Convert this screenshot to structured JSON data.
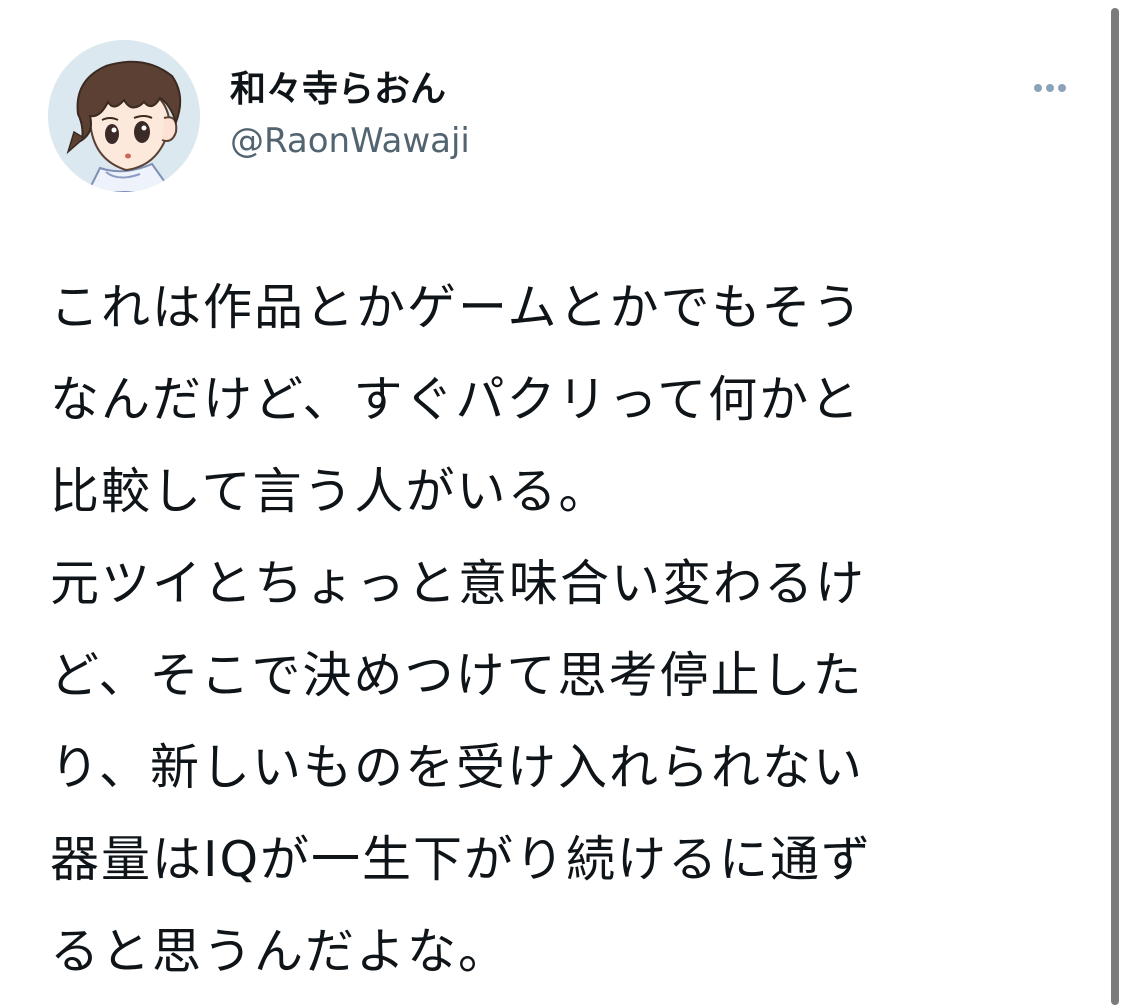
{
  "tweet": {
    "display_name": "和々寺らおん",
    "handle": "@RaonWawaji",
    "more_icon": "more-horizontal-icon",
    "avatar_icon": "anime-boy-avatar",
    "text_lines": [
      "これは作品とかゲームとかでもそう",
      "なんだけど、すぐパクリって何かと",
      "比較して言う人がいる。",
      "元ツイとちょっと意味合い変わるけ",
      "ど、そこで決めつけて思考停止した",
      "り、新しいものを受け入れられない",
      "器量はIQが一生下がり続けるに通ず",
      "ると思うんだよな。"
    ]
  },
  "colors": {
    "text": "#0f1419",
    "secondary": "#536471",
    "more_dots": "#8ba3b8",
    "scrollbar": "#7b7b7b"
  }
}
